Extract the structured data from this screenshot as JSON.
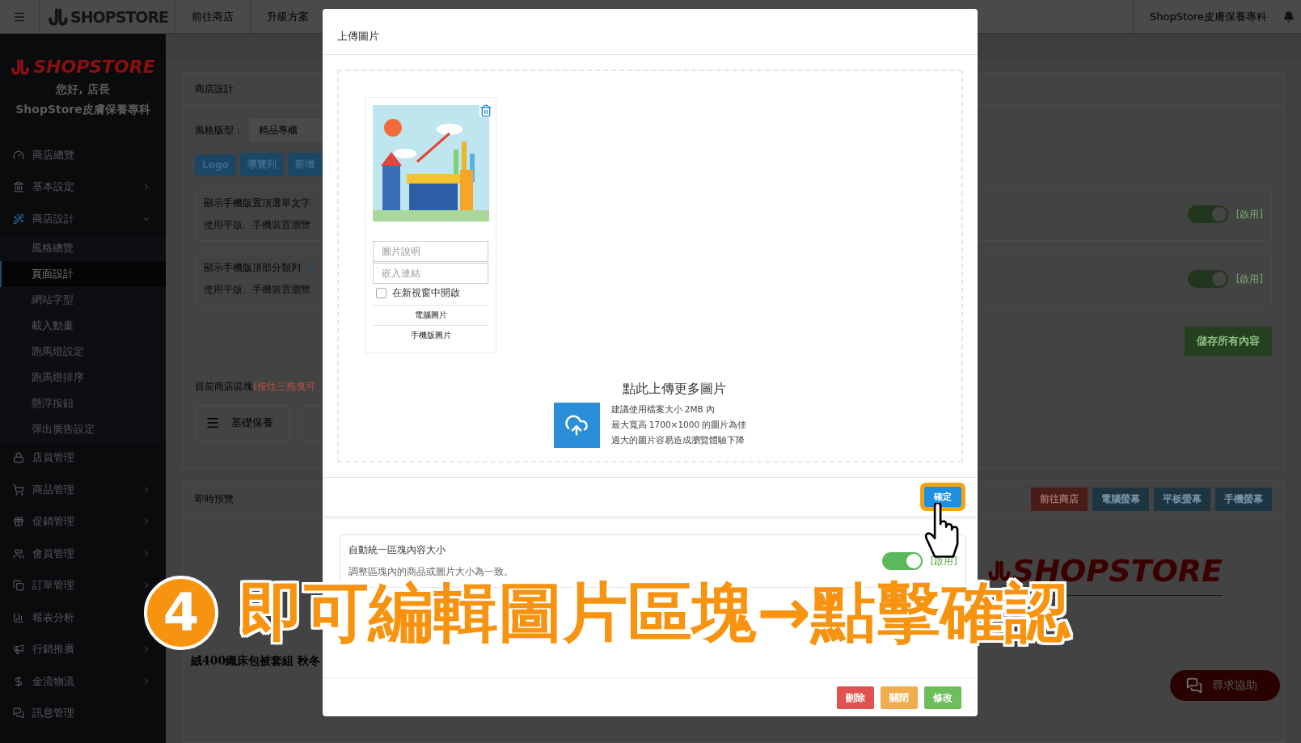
{
  "topbar": {
    "logo": "SHOPSTORE",
    "nav": [
      {
        "label": "前往商店"
      },
      {
        "label": "升級方案"
      }
    ],
    "store_name": "ShopStore皮膚保養專科"
  },
  "sidebar": {
    "logo": "SHOPSTORE",
    "greeting": "您好, 店長",
    "store_name": "ShopStore皮膚保養專科",
    "items": [
      {
        "label": "商店總覽",
        "kind": "link"
      },
      {
        "label": "基本設定",
        "kind": "group",
        "expanded": false
      },
      {
        "label": "商店設計",
        "kind": "group",
        "expanded": true,
        "children": [
          {
            "label": "風格總覽",
            "selected": false
          },
          {
            "label": "頁面設計",
            "selected": true
          },
          {
            "label": "網站字型",
            "selected": false
          },
          {
            "label": "載入動畫",
            "selected": false
          },
          {
            "label": "跑馬燈設定",
            "selected": false
          },
          {
            "label": "跑馬燈排序",
            "selected": false
          },
          {
            "label": "懸浮按鈕",
            "selected": false
          },
          {
            "label": "彈出廣告設定",
            "selected": false
          }
        ]
      },
      {
        "label": "店員管理",
        "kind": "link"
      },
      {
        "label": "商品管理",
        "kind": "group",
        "expanded": false
      },
      {
        "label": "促銷管理",
        "kind": "group",
        "expanded": false
      },
      {
        "label": "會員管理",
        "kind": "group",
        "expanded": false
      },
      {
        "label": "訂單管理",
        "kind": "group",
        "expanded": false
      },
      {
        "label": "報表分析",
        "kind": "group",
        "expanded": false
      },
      {
        "label": "行銷推廣",
        "kind": "group",
        "expanded": false
      },
      {
        "label": "金流物流",
        "kind": "group",
        "expanded": false
      },
      {
        "label": "訊息管理",
        "kind": "link"
      }
    ]
  },
  "design_card": {
    "title": "商店設計",
    "style_label": "風格版型：",
    "style_value": "精品專櫃",
    "buttons": [
      {
        "label": "Logo"
      },
      {
        "label": "導覽列"
      },
      {
        "label": "新增"
      }
    ],
    "settings": [
      {
        "title": "顯示手機版置頂選單文字",
        "help": false,
        "description": "使用平版、手機裝置瀏覽",
        "on": true,
        "state_label": "[啟用]"
      },
      {
        "title": "顯示手機版頂部分類列",
        "help": true,
        "description": "使用平版、手機裝置瀏覽",
        "on": true,
        "state_label": "[啟用]"
      }
    ],
    "save_button": "儲存所有內容",
    "blocks_label": "目前商店區塊",
    "blocks_hint": "(按住三拖曳可",
    "blocks": [
      {
        "label": "基礎保養"
      }
    ]
  },
  "preview_card": {
    "title": "即時預覽",
    "buttons": [
      {
        "label": "前往商店",
        "kind": "shop"
      },
      {
        "label": "電腦螢幕",
        "kind": "device"
      },
      {
        "label": "平板螢幕",
        "kind": "device"
      },
      {
        "label": "手機螢幕",
        "kind": "device"
      }
    ],
    "logo": "SHOPSTORE",
    "product_title": "絨400織床包被套組 秋冬"
  },
  "help_button": "尋求協助",
  "modal": {
    "title": "上傳圖片",
    "images": [
      {
        "kind": "picture",
        "caption_placeholder": "圖片說明",
        "link_placeholder": "嵌入連結",
        "new_window_label": "在新視窗中開啟",
        "new_window": false,
        "links": [
          "電腦圖片",
          "手機版圖片"
        ]
      }
    ],
    "upload_title": "點此上傳更多圖片",
    "upload_notes": [
      "建議使用檔案大小 2MB 內",
      "最大寬高 1700×1000 的圖片為佳",
      "過大的圖片容易造成瀏覽體驗下降"
    ],
    "confirm": "確定"
  },
  "block_editor": {
    "settings": [
      {
        "title": "自動統一區塊內容大小",
        "description": "調整區塊內的商品或圖片大小為一致。",
        "on": true,
        "state_label": "[啟用]"
      }
    ],
    "buttons": [
      {
        "label": "刪除",
        "kind": "danger"
      },
      {
        "label": "關閉",
        "kind": "warning"
      },
      {
        "label": "修改",
        "kind": "success"
      }
    ]
  },
  "tutorial": {
    "step": "4",
    "caption": "即可編輯圖片區塊→點擊確認"
  }
}
